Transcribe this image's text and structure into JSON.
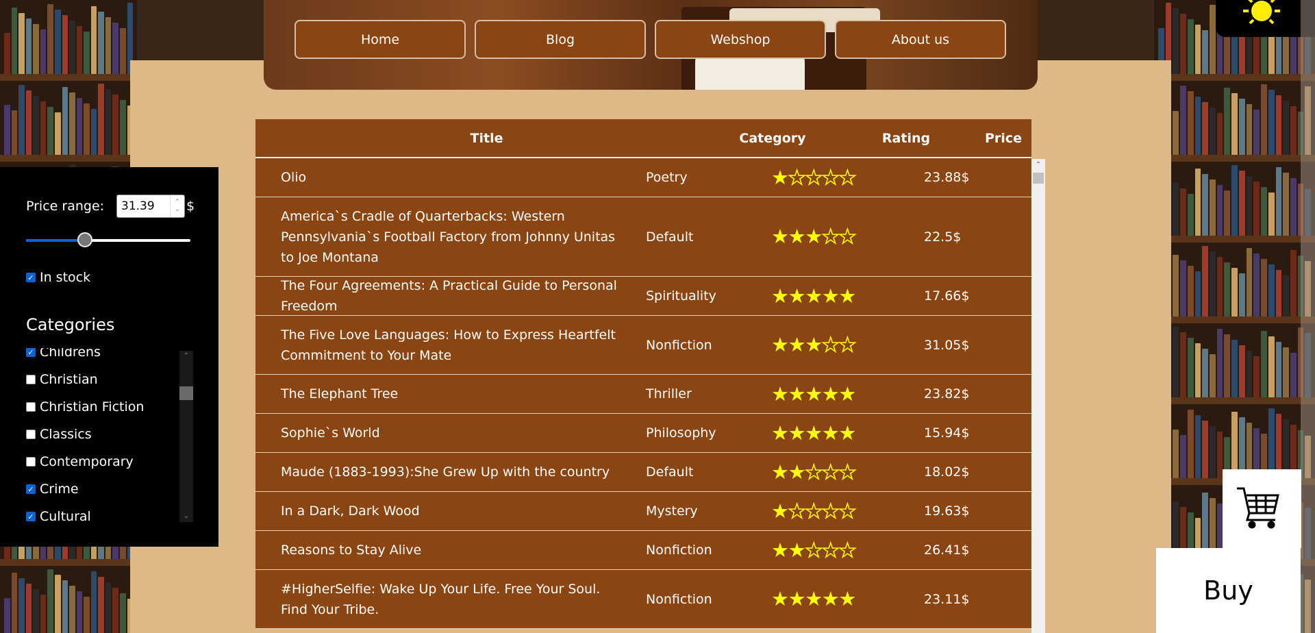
{
  "nav": {
    "items": [
      {
        "label": "Home"
      },
      {
        "label": "Blog"
      },
      {
        "label": "Webshop"
      },
      {
        "label": "About us"
      }
    ]
  },
  "theme_toggle": {
    "icon": "sun-icon",
    "color": "#ffee00"
  },
  "filters": {
    "price_label": "Price range:",
    "price_value": "31.39",
    "currency": "$",
    "slider_fraction": 0.36,
    "in_stock_label": "In stock",
    "in_stock_checked": true,
    "categories_title": "Categories",
    "categories": [
      {
        "label": "Childrens",
        "checked": true
      },
      {
        "label": "Christian",
        "checked": false
      },
      {
        "label": "Christian Fiction",
        "checked": false
      },
      {
        "label": "Classics",
        "checked": false
      },
      {
        "label": "Contemporary",
        "checked": false
      },
      {
        "label": "Crime",
        "checked": true
      },
      {
        "label": "Cultural",
        "checked": true
      }
    ]
  },
  "table": {
    "headers": {
      "title": "Title",
      "category": "Category",
      "rating": "Rating",
      "price": "Price"
    },
    "rows": [
      {
        "title": "Olio",
        "category": "Poetry",
        "rating": 1,
        "price": "23.88$"
      },
      {
        "title": "America`s Cradle of Quarterbacks: Western Pennsylvania`s Football Factory from Johnny Unitas to Joe Montana",
        "category": "Default",
        "rating": 3,
        "price": "22.5$"
      },
      {
        "title": "The Four Agreements: A Practical Guide to Personal Freedom",
        "category": "Spirituality",
        "rating": 5,
        "price": "17.66$"
      },
      {
        "title": "The Five Love Languages: How to Express Heartfelt Commitment to Your Mate",
        "category": "Nonfiction",
        "rating": 3,
        "price": "31.05$"
      },
      {
        "title": "The Elephant Tree",
        "category": "Thriller",
        "rating": 5,
        "price": "23.82$"
      },
      {
        "title": "Sophie`s World",
        "category": "Philosophy",
        "rating": 5,
        "price": "15.94$"
      },
      {
        "title": "Maude (1883-1993):She Grew Up with the country",
        "category": "Default",
        "rating": 2,
        "price": "18.02$"
      },
      {
        "title": "In a Dark, Dark Wood",
        "category": "Mystery",
        "rating": 1,
        "price": "19.63$"
      },
      {
        "title": "Reasons to Stay Alive",
        "category": "Nonfiction",
        "rating": 2,
        "price": "26.41$"
      },
      {
        "title": "#HigherSelfie: Wake Up Your Life. Free Your Soul. Find Your Tribe.",
        "category": "Nonfiction",
        "rating": 5,
        "price": "23.11$"
      }
    ]
  },
  "cart": {
    "icon": "cart-icon"
  },
  "buy": {
    "label": "Buy"
  },
  "colors": {
    "accent": "#8b4513",
    "panel": "#deb887",
    "star": "#ffff00",
    "sidebar": "#000000"
  }
}
